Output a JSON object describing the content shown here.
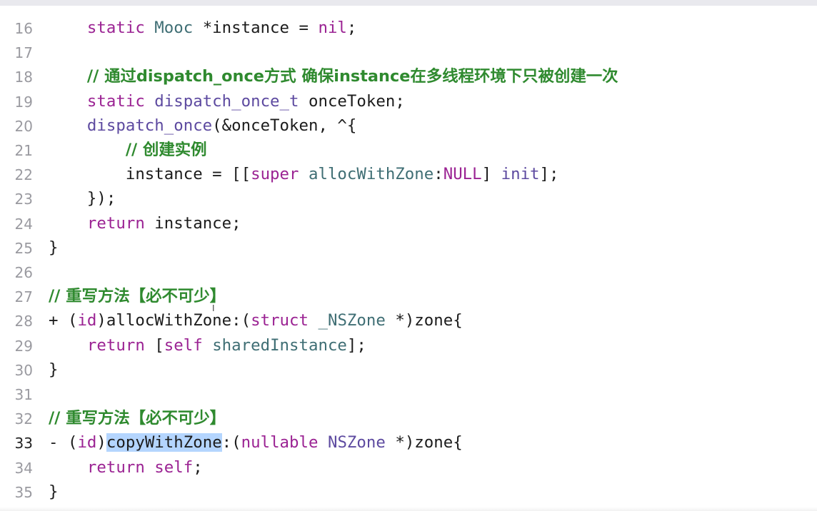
{
  "editor": {
    "lines": [
      {
        "number": "16",
        "current": false,
        "tokens": [
          {
            "t": "    ",
            "c": "plain"
          },
          {
            "t": "static",
            "c": "kw"
          },
          {
            "t": " ",
            "c": "plain"
          },
          {
            "t": "Mooc",
            "c": "type"
          },
          {
            "t": " *instance = ",
            "c": "plain"
          },
          {
            "t": "nil",
            "c": "kw"
          },
          {
            "t": ";",
            "c": "plain"
          }
        ]
      },
      {
        "number": "17",
        "current": false,
        "tokens": []
      },
      {
        "number": "18",
        "current": false,
        "tokens": [
          {
            "t": "    ",
            "c": "plain"
          },
          {
            "t": "// 通过dispatch_once方式 确保instance在多线程环境下只被创建一次",
            "c": "comment-zh"
          }
        ]
      },
      {
        "number": "19",
        "current": false,
        "tokens": [
          {
            "t": "    ",
            "c": "plain"
          },
          {
            "t": "static",
            "c": "kw"
          },
          {
            "t": " ",
            "c": "plain"
          },
          {
            "t": "dispatch_once_t",
            "c": "type2"
          },
          {
            "t": " onceToken;",
            "c": "plain"
          }
        ]
      },
      {
        "number": "20",
        "current": false,
        "tokens": [
          {
            "t": "    ",
            "c": "plain"
          },
          {
            "t": "dispatch_once",
            "c": "type2"
          },
          {
            "t": "(&onceToken, ^{",
            "c": "plain"
          }
        ]
      },
      {
        "number": "21",
        "current": false,
        "tokens": [
          {
            "t": "        ",
            "c": "plain"
          },
          {
            "t": "// 创建实例",
            "c": "comment-zh"
          }
        ]
      },
      {
        "number": "22",
        "current": false,
        "tokens": [
          {
            "t": "        instance = [[",
            "c": "plain"
          },
          {
            "t": "super",
            "c": "kw"
          },
          {
            "t": " ",
            "c": "plain"
          },
          {
            "t": "allocWithZone",
            "c": "type"
          },
          {
            "t": ":",
            "c": "plain"
          },
          {
            "t": "NULL",
            "c": "kw"
          },
          {
            "t": "] ",
            "c": "plain"
          },
          {
            "t": "init",
            "c": "type2"
          },
          {
            "t": "];",
            "c": "plain"
          }
        ]
      },
      {
        "number": "23",
        "current": false,
        "tokens": [
          {
            "t": "    });",
            "c": "plain"
          }
        ]
      },
      {
        "number": "24",
        "current": false,
        "tokens": [
          {
            "t": "    ",
            "c": "plain"
          },
          {
            "t": "return",
            "c": "kw"
          },
          {
            "t": " instance;",
            "c": "plain"
          }
        ]
      },
      {
        "number": "25",
        "current": false,
        "tokens": [
          {
            "t": "}",
            "c": "plain"
          }
        ]
      },
      {
        "number": "26",
        "current": false,
        "tokens": []
      },
      {
        "number": "27",
        "current": false,
        "tokens": [
          {
            "t": "// 重写方法【必不可少】",
            "c": "comment-zh"
          }
        ]
      },
      {
        "number": "28",
        "current": false,
        "tokens": [
          {
            "t": "+ (",
            "c": "plain"
          },
          {
            "t": "id",
            "c": "kw"
          },
          {
            "t": ")allocWithZone:(",
            "c": "plain"
          },
          {
            "t": "struct",
            "c": "kw"
          },
          {
            "t": " ",
            "c": "plain"
          },
          {
            "t": "_NSZone",
            "c": "type"
          },
          {
            "t": " *)zone{",
            "c": "plain"
          }
        ]
      },
      {
        "number": "29",
        "current": false,
        "tokens": [
          {
            "t": "    ",
            "c": "plain"
          },
          {
            "t": "return",
            "c": "kw"
          },
          {
            "t": " [",
            "c": "plain"
          },
          {
            "t": "self",
            "c": "kw"
          },
          {
            "t": " ",
            "c": "plain"
          },
          {
            "t": "sharedInstance",
            "c": "type"
          },
          {
            "t": "];",
            "c": "plain"
          }
        ]
      },
      {
        "number": "30",
        "current": false,
        "tokens": [
          {
            "t": "}",
            "c": "plain"
          }
        ]
      },
      {
        "number": "31",
        "current": false,
        "tokens": []
      },
      {
        "number": "32",
        "current": false,
        "tokens": [
          {
            "t": "// 重写方法【必不可少】",
            "c": "comment-zh"
          }
        ]
      },
      {
        "number": "33",
        "current": true,
        "tokens": [
          {
            "t": "- (",
            "c": "plain"
          },
          {
            "t": "id",
            "c": "kw"
          },
          {
            "t": ")",
            "c": "plain"
          },
          {
            "t": "copyWithZone",
            "c": "sel"
          },
          {
            "t": ":(",
            "c": "plain"
          },
          {
            "t": "nullable",
            "c": "kw"
          },
          {
            "t": " ",
            "c": "plain"
          },
          {
            "t": "NSZone",
            "c": "type2"
          },
          {
            "t": " *)zone{",
            "c": "plain"
          }
        ]
      },
      {
        "number": "34",
        "current": false,
        "tokens": [
          {
            "t": "    ",
            "c": "plain"
          },
          {
            "t": "return",
            "c": "kw"
          },
          {
            "t": " ",
            "c": "plain"
          },
          {
            "t": "self",
            "c": "kw"
          },
          {
            "t": ";",
            "c": "plain"
          }
        ]
      },
      {
        "number": "35",
        "current": false,
        "tokens": [
          {
            "t": "}",
            "c": "plain"
          }
        ]
      }
    ]
  }
}
